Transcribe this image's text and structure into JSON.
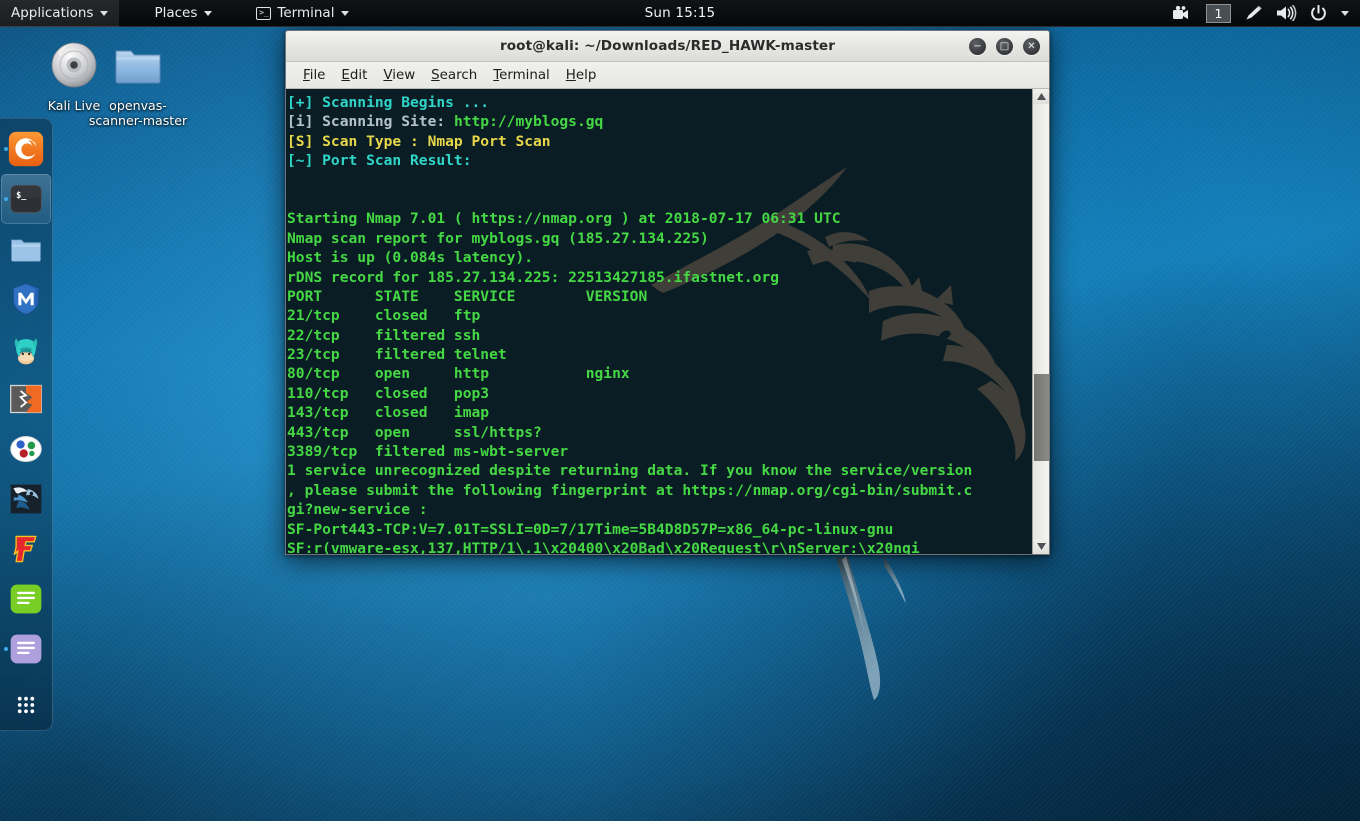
{
  "panel": {
    "applications": "Applications",
    "places": "Places",
    "terminal_menu": "Terminal",
    "terminal_icon": "terminal-small-icon",
    "clock": "Sun 15:15",
    "workspace": "1",
    "tray": [
      {
        "name": "camera-recorder-icon"
      },
      {
        "name": "pen-tablet-icon"
      },
      {
        "name": "volume-icon"
      },
      {
        "name": "power-icon"
      }
    ]
  },
  "desktop": {
    "icons": [
      {
        "name": "kali-live-disc",
        "label": "Kali Live",
        "type": "disc"
      },
      {
        "name": "openvas-folder",
        "label": "openvas-scanner-master",
        "type": "folder"
      }
    ]
  },
  "dock": {
    "items": [
      {
        "name": "firefox",
        "label": "Firefox ESR",
        "running": true,
        "active": false
      },
      {
        "name": "terminal",
        "label": "Terminal",
        "running": true,
        "active": true
      },
      {
        "name": "files",
        "label": "Files",
        "running": false,
        "active": false
      },
      {
        "name": "metasploit",
        "label": "Metasploit",
        "running": false,
        "active": false
      },
      {
        "name": "armitage",
        "label": "Armitage",
        "running": false,
        "active": false
      },
      {
        "name": "burpsuite",
        "label": "Burp Suite",
        "running": false,
        "active": false
      },
      {
        "name": "beef",
        "label": "BeEF",
        "running": false,
        "active": false
      },
      {
        "name": "maltego",
        "label": "Maltego",
        "running": false,
        "active": false
      },
      {
        "name": "faraday",
        "label": "Faraday IDE",
        "running": false,
        "active": false
      },
      {
        "name": "text-editor-green",
        "label": "Text Editor",
        "running": false,
        "active": false
      },
      {
        "name": "text-editor-purple",
        "label": "Documents",
        "running": true,
        "active": false
      },
      {
        "name": "show-applications",
        "label": "Show Applications",
        "running": false,
        "active": false
      }
    ]
  },
  "window": {
    "title": "root@kali: ~/Downloads/RED_HAWK-master",
    "buttons": {
      "minimize": "−",
      "maximize": "□",
      "close": "✕"
    },
    "menus": [
      {
        "mnemonic": "F",
        "rest": "ile"
      },
      {
        "mnemonic": "E",
        "rest": "dit"
      },
      {
        "mnemonic": "V",
        "rest": "iew"
      },
      {
        "mnemonic": "S",
        "rest": "earch"
      },
      {
        "mnemonic": "T",
        "rest": "erminal"
      },
      {
        "mnemonic": "H",
        "rest": "elp"
      }
    ]
  },
  "terminal": {
    "colors": {
      "background": "#0b1d24",
      "green": "#45d845",
      "cyan": "#2fd6c8",
      "yellow": "#e6d74a",
      "gray_blue": "#b7c3cc"
    },
    "scrollbar": {
      "thumb_top_pct": 62,
      "thumb_height_pct": 20
    },
    "lines": [
      {
        "segments": [
          {
            "text": "[+] Scanning Begins ...",
            "color": "c-cyan"
          }
        ]
      },
      {
        "segments": [
          {
            "text": "[i] Scanning Site: ",
            "color": "c-grayb"
          },
          {
            "text": "http://myblogs.gq",
            "color": "c-green"
          }
        ]
      },
      {
        "segments": [
          {
            "text": "[S] Scan Type : Nmap Port Scan",
            "color": "c-yellow"
          }
        ]
      },
      {
        "segments": [
          {
            "text": "[~] Port Scan Result:",
            "color": "c-cyan"
          }
        ]
      },
      {
        "segments": [
          {
            "text": "",
            "color": "c-green"
          }
        ]
      },
      {
        "segments": [
          {
            "text": "",
            "color": "c-green"
          }
        ]
      },
      {
        "segments": [
          {
            "text": "Starting Nmap 7.01 ( https://nmap.org ) at 2018-07-17 06:31 UTC",
            "color": "c-green"
          }
        ]
      },
      {
        "segments": [
          {
            "text": "Nmap scan report for myblogs.gq (185.27.134.225)",
            "color": "c-green"
          }
        ]
      },
      {
        "segments": [
          {
            "text": "Host is up (0.084s latency).",
            "color": "c-green"
          }
        ]
      },
      {
        "segments": [
          {
            "text": "rDNS record for 185.27.134.225: 22513427185.ifastnet.org",
            "color": "c-green"
          }
        ]
      },
      {
        "segments": [
          {
            "text": "PORT      STATE    SERVICE        VERSION",
            "color": "c-green"
          }
        ]
      },
      {
        "segments": [
          {
            "text": "21/tcp    closed   ftp",
            "color": "c-green"
          }
        ]
      },
      {
        "segments": [
          {
            "text": "22/tcp    filtered ssh",
            "color": "c-green"
          }
        ]
      },
      {
        "segments": [
          {
            "text": "23/tcp    filtered telnet",
            "color": "c-green"
          }
        ]
      },
      {
        "segments": [
          {
            "text": "80/tcp    open     http           nginx",
            "color": "c-green"
          }
        ]
      },
      {
        "segments": [
          {
            "text": "110/tcp   closed   pop3",
            "color": "c-green"
          }
        ]
      },
      {
        "segments": [
          {
            "text": "143/tcp   closed   imap",
            "color": "c-green"
          }
        ]
      },
      {
        "segments": [
          {
            "text": "443/tcp   open     ssl/https?",
            "color": "c-green"
          }
        ]
      },
      {
        "segments": [
          {
            "text": "3389/tcp  filtered ms-wbt-server",
            "color": "c-green"
          }
        ]
      },
      {
        "segments": [
          {
            "text": "1 service unrecognized despite returning data. If you know the service/version",
            "color": "c-green"
          }
        ]
      },
      {
        "segments": [
          {
            "text": ", please submit the following fingerprint at https://nmap.org/cgi-bin/submit.c",
            "color": "c-green"
          }
        ]
      },
      {
        "segments": [
          {
            "text": "gi?new-service :",
            "color": "c-green"
          }
        ]
      },
      {
        "segments": [
          {
            "text": "SF-Port443-TCP:V=7.01T=SSLI=0D=7/17Time=5B4D8D57P=x86_64-pc-linux-gnu",
            "color": "c-green"
          }
        ]
      },
      {
        "segments": [
          {
            "text": "SF:r(vmware-esx,137,HTTP/1\\.1\\x20400\\x20Bad\\x20Request\\r\\nServer:\\x20ngi",
            "color": "c-green"
          }
        ]
      }
    ],
    "scan": {
      "site": "http://myblogs.gq",
      "scan_type": "Nmap Port Scan",
      "nmap_version": "7.01",
      "timestamp": "2018-07-17 06:31 UTC",
      "host": "myblogs.gq",
      "ip": "185.27.134.225",
      "latency": "0.084s",
      "rdns": "22513427185.ifastnet.org",
      "columns": [
        "PORT",
        "STATE",
        "SERVICE",
        "VERSION"
      ],
      "ports": [
        {
          "port": "21/tcp",
          "state": "closed",
          "service": "ftp",
          "version": ""
        },
        {
          "port": "22/tcp",
          "state": "filtered",
          "service": "ssh",
          "version": ""
        },
        {
          "port": "23/tcp",
          "state": "filtered",
          "service": "telnet",
          "version": ""
        },
        {
          "port": "80/tcp",
          "state": "open",
          "service": "http",
          "version": "nginx"
        },
        {
          "port": "110/tcp",
          "state": "closed",
          "service": "pop3",
          "version": ""
        },
        {
          "port": "143/tcp",
          "state": "closed",
          "service": "imap",
          "version": ""
        },
        {
          "port": "443/tcp",
          "state": "open",
          "service": "ssl/https?",
          "version": ""
        },
        {
          "port": "3389/tcp",
          "state": "filtered",
          "service": "ms-wbt-server",
          "version": ""
        }
      ]
    }
  }
}
